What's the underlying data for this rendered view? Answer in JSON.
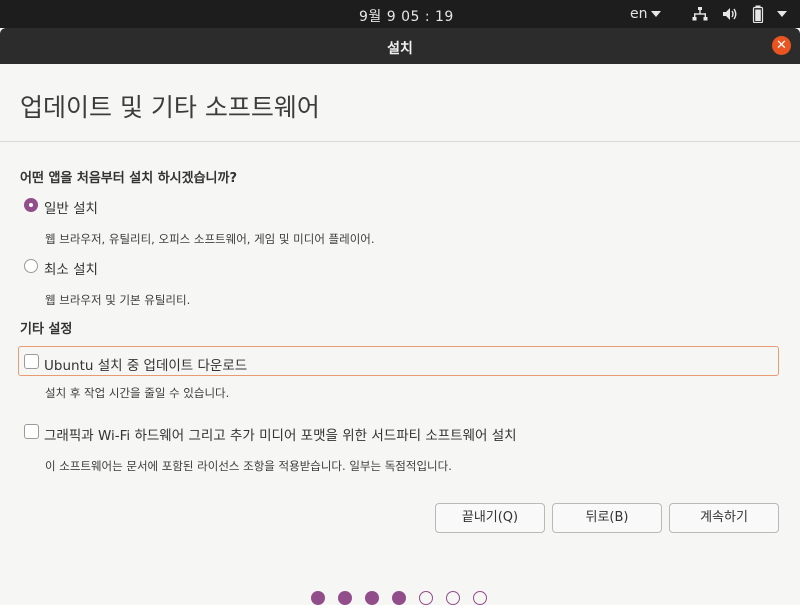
{
  "topbar": {
    "clock": "9월 9 05 : 19",
    "language": "en"
  },
  "window": {
    "title": "설치"
  },
  "page": {
    "heading": "업데이트 및 기타 소프트웨어"
  },
  "install_type": {
    "question": "어떤 앱을 처음부터 설치 하시겠습니까?",
    "options": [
      {
        "label": "일반 설치",
        "description": "웹 브라우저, 유틸리티, 오피스  소프트웨어, 게임 및 미디어 플레이어.",
        "selected": true
      },
      {
        "label": "최소 설치",
        "description": "웹 브라우저 및 기본 유틸리티.",
        "selected": false
      }
    ]
  },
  "other_settings": {
    "title": "기타 설정",
    "items": [
      {
        "label": "Ubuntu 설치 중 업데이트 다운로드",
        "description": "설치 후 작업 시간을 줄일 수 있습니다.",
        "checked": false
      },
      {
        "label": "그래픽과 Wi-Fi 하드웨어 그리고 추가 미디어 포맷을 위한 서드파티 소프트웨어 설치",
        "description": "이 소프트웨어는 문서에 포함된 라이선스 조항을 적용받습니다. 일부는 독점적입니다.",
        "checked": false
      }
    ]
  },
  "buttons": {
    "quit": "끝내기(Q)",
    "back": "뒤로(B)",
    "continue": "계속하기"
  },
  "progress": {
    "completed_steps": 4,
    "total_steps": 7
  },
  "colors": {
    "accent": "#924d8b",
    "close": "#e95420"
  }
}
